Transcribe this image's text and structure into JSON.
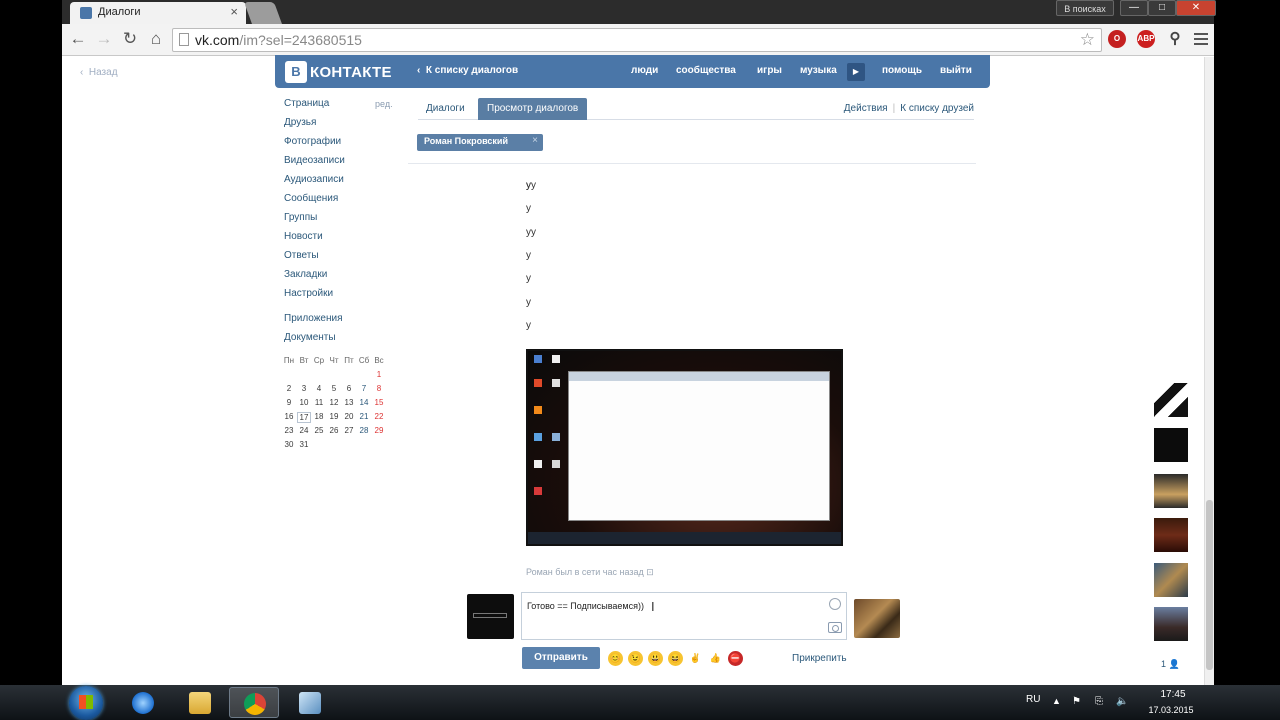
{
  "browser": {
    "tab_title": "Диалоги",
    "tab_close": "×",
    "search_label": "В поисках",
    "url_host": "vk.com",
    "url_path": "/im?sel=243680515",
    "window_buttons": {
      "min": "—",
      "max": "□",
      "close": "✕"
    }
  },
  "page": {
    "back_label": "Назад"
  },
  "vk_header": {
    "logo_mark": "В",
    "logo_text": "КОНТАКТЕ",
    "back_to_list": "К списку диалогов",
    "nav": [
      "люди",
      "сообщества",
      "игры",
      "музыка",
      "помощь",
      "выйти"
    ],
    "play_icon": "▶"
  },
  "left_menu": {
    "edit_label": "ред.",
    "items": [
      "Страница",
      "Друзья",
      "Фотографии",
      "Видеозаписи",
      "Аудиозаписи",
      "Сообщения",
      "Группы",
      "Новости",
      "Ответы",
      "Закладки",
      "Настройки"
    ],
    "extra": [
      "Приложения",
      "Документы"
    ]
  },
  "calendar": {
    "weekdays": [
      "Пн",
      "Вт",
      "Ср",
      "Чт",
      "Пт",
      "Сб",
      "Вс"
    ],
    "weeks": [
      [
        "",
        "",
        "",
        "",
        "",
        "",
        "1"
      ],
      [
        "2",
        "3",
        "4",
        "5",
        "6",
        "7",
        "8"
      ],
      [
        "9",
        "10",
        "11",
        "12",
        "13",
        "14",
        "15"
      ],
      [
        "16",
        "17",
        "18",
        "19",
        "20",
        "21",
        "22"
      ],
      [
        "23",
        "24",
        "25",
        "26",
        "27",
        "28",
        "29"
      ],
      [
        "30",
        "31",
        "",
        "",
        "",
        "",
        ""
      ]
    ],
    "today": "17"
  },
  "dialog_tabs": {
    "dialogs": "Диалоги",
    "view": "Просмотр диалогов",
    "actions": "Действия",
    "friends": "К списку друзей"
  },
  "person": {
    "name": "Роман Покровский",
    "close": "×"
  },
  "messages": [
    "у",
    "уу",
    "у",
    "уу",
    "у",
    "у",
    "у",
    "у"
  ],
  "last_seen": "Роман был в сети час назад ⊡",
  "compose": {
    "text": "Готово == Подписываемся))",
    "send": "Отправить",
    "attach": "Прикрепить"
  },
  "emojis": [
    "😊",
    "😉",
    "😃",
    "😆",
    "✌",
    "👍",
    "⛔"
  ],
  "online_count": "1 👤",
  "taskbar": {
    "lang": "RU",
    "time": "17:45",
    "date": "17.03.2015"
  },
  "colors": {
    "vk_blue": "#4a76a8",
    "link": "#2b587a",
    "send_button": "#5b82ad"
  }
}
